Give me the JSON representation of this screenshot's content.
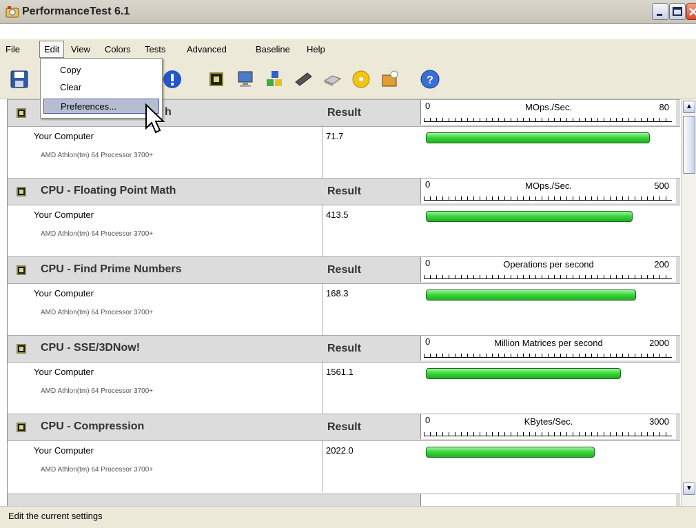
{
  "window": {
    "title": "PerformanceTest 6.1"
  },
  "menu": [
    "File",
    "Edit",
    "View",
    "Colors",
    "Tests",
    "Advanced",
    "Baseline",
    "Help"
  ],
  "edit_menu": {
    "items": [
      "Copy",
      "Clear",
      "Preferences..."
    ],
    "selected": "Preferences..."
  },
  "toolbar": [
    "save-icon",
    "run-icon",
    "cpu-icon",
    "monitor-icon",
    "blocks-icon",
    "memory-icon",
    "disk-icon",
    "cd-icon",
    "3d-icon",
    "help-icon"
  ],
  "header_partial": "h",
  "tests": [
    {
      "name": "",
      "result_label": "Result",
      "unit": "MOps./Sec.",
      "scale_min": "0",
      "scale_max": "80",
      "computer": "Your Computer",
      "cpu": "AMD Athlon(tm) 64 Processor 3700+",
      "value": "71.7",
      "fraction": 0.896
    },
    {
      "name": "CPU - Floating Point Math",
      "result_label": "Result",
      "unit": "MOps./Sec.",
      "scale_min": "0",
      "scale_max": "500",
      "computer": "Your Computer",
      "cpu": "AMD Athlon(tm) 64 Processor 3700+",
      "value": "413.5",
      "fraction": 0.827
    },
    {
      "name": "CPU - Find Prime Numbers",
      "result_label": "Result",
      "unit": "Operations per second",
      "scale_min": "0",
      "scale_max": "200",
      "computer": "Your Computer",
      "cpu": "AMD Athlon(tm) 64 Processor 3700+",
      "value": "168.3",
      "fraction": 0.842
    },
    {
      "name": "CPU - SSE/3DNow!",
      "result_label": "Result",
      "unit": "Million Matrices per second",
      "scale_min": "0",
      "scale_max": "2000",
      "computer": "Your Computer",
      "cpu": "AMD Athlon(tm) 64 Processor 3700+",
      "value": "1561.1",
      "fraction": 0.781
    },
    {
      "name": "CPU - Compression",
      "result_label": "Result",
      "unit": "KBytes/Sec.",
      "scale_min": "0",
      "scale_max": "3000",
      "computer": "Your Computer",
      "cpu": "AMD Athlon(tm) 64 Processor 3700+",
      "value": "2022.0",
      "fraction": 0.674
    }
  ],
  "status": "Edit the current settings"
}
